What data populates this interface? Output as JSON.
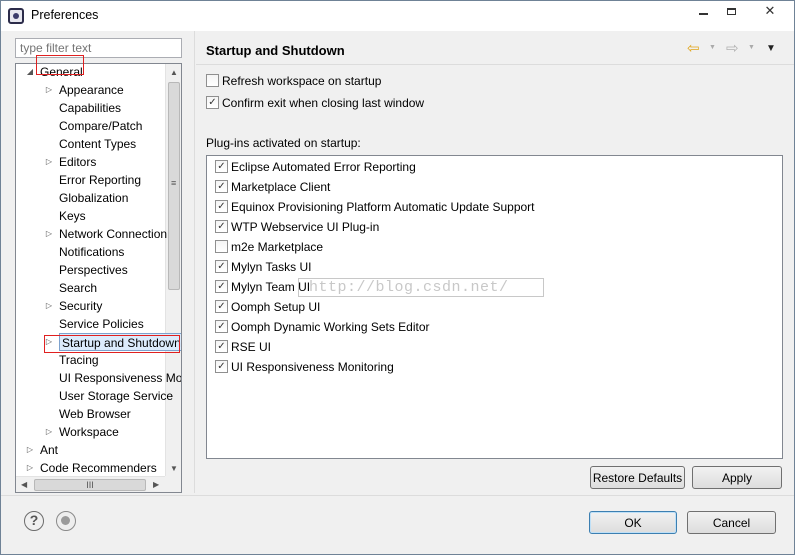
{
  "window": {
    "title": "Preferences"
  },
  "filter": {
    "placeholder": "type filter text"
  },
  "tree": {
    "items": [
      {
        "label": "General",
        "expandable": true,
        "expanded": true
      },
      {
        "label": "Appearance",
        "expandable": true
      },
      {
        "label": "Capabilities"
      },
      {
        "label": "Compare/Patch"
      },
      {
        "label": "Content Types"
      },
      {
        "label": "Editors",
        "expandable": true
      },
      {
        "label": "Error Reporting"
      },
      {
        "label": "Globalization"
      },
      {
        "label": "Keys"
      },
      {
        "label": "Network Connection",
        "expandable": true
      },
      {
        "label": "Notifications"
      },
      {
        "label": "Perspectives"
      },
      {
        "label": "Search"
      },
      {
        "label": "Security",
        "expandable": true
      },
      {
        "label": "Service Policies"
      },
      {
        "label": "Startup and Shutdown",
        "expandable": true,
        "selected": true
      },
      {
        "label": "Tracing"
      },
      {
        "label": "UI Responsiveness Monitoring"
      },
      {
        "label": "User Storage Service"
      },
      {
        "label": "Web Browser"
      },
      {
        "label": "Workspace",
        "expandable": true
      },
      {
        "label": "Ant",
        "expandable": true
      },
      {
        "label": "Code Recommenders",
        "expandable": true
      }
    ]
  },
  "page": {
    "title": "Startup and Shutdown",
    "options": [
      {
        "label": "Refresh workspace on startup",
        "checked": false
      },
      {
        "label": "Confirm exit when closing last window",
        "checked": true
      }
    ],
    "plugins_label": "Plug-ins activated on startup:",
    "plugins": [
      {
        "label": "Eclipse Automated Error Reporting",
        "checked": true
      },
      {
        "label": "Marketplace Client",
        "checked": true
      },
      {
        "label": "Equinox Provisioning Platform Automatic Update Support",
        "checked": true
      },
      {
        "label": "WTP Webservice UI Plug-in",
        "checked": true
      },
      {
        "label": "m2e Marketplace",
        "checked": false
      },
      {
        "label": "Mylyn Tasks UI",
        "checked": true
      },
      {
        "label": "Mylyn Team UI",
        "checked": true
      },
      {
        "label": "Oomph Setup UI",
        "checked": true
      },
      {
        "label": "Oomph Dynamic Working Sets Editor",
        "checked": true
      },
      {
        "label": "RSE UI",
        "checked": true
      },
      {
        "label": "UI Responsiveness Monitoring",
        "checked": true
      }
    ],
    "watermark": "http://blog.csdn.net/"
  },
  "buttons": {
    "restore_defaults": "Restore Defaults",
    "apply": "Apply",
    "ok": "OK",
    "cancel": "Cancel"
  },
  "glyphs": {
    "help": "?",
    "check": "✓",
    "minimize": "",
    "close": "✕",
    "back": "⇦",
    "forward": "⇨",
    "dropdown": "▼",
    "tree_collapsed": "▷",
    "tree_expanded": "◢",
    "scroll_up": "▲",
    "scroll_down": "▼",
    "scroll_left": "◀",
    "scroll_right": "▶",
    "grip_v": "≡",
    "grip_h": "III"
  },
  "colors": {
    "selection": "#dcebfc",
    "highlight_box": "#e02020",
    "back_arrow": "#e1a51c"
  }
}
